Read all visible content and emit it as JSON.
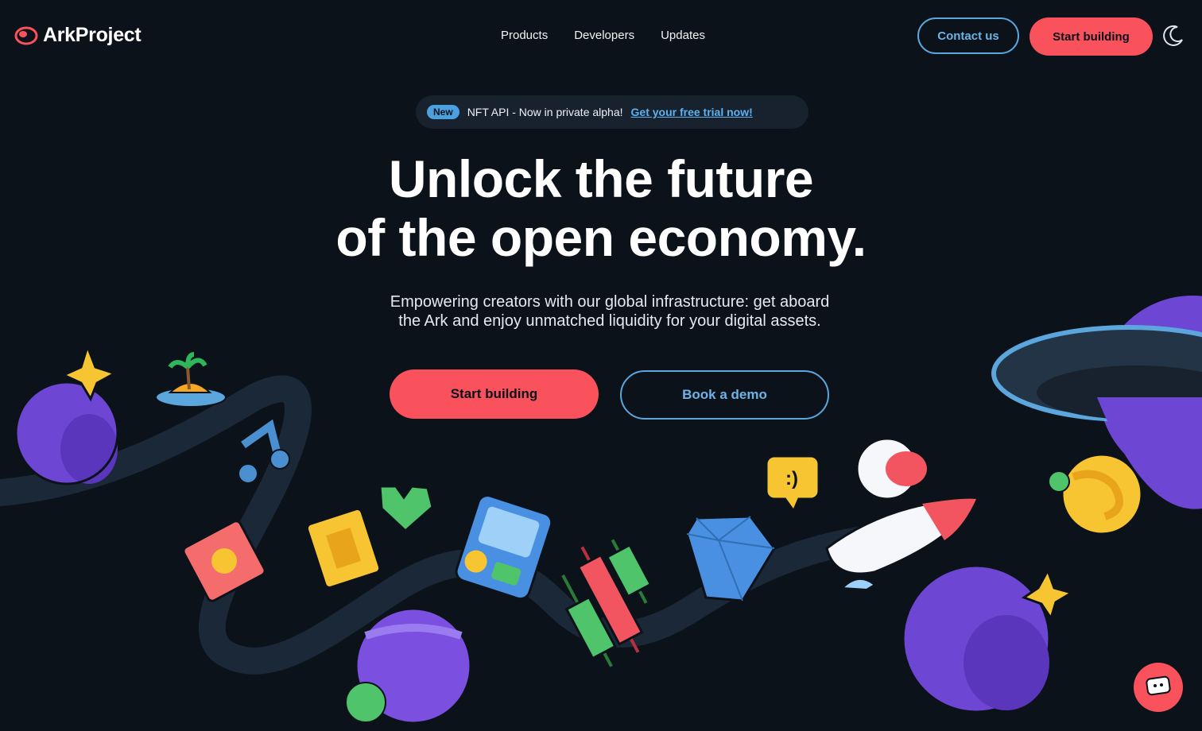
{
  "header": {
    "brand": "ArkProject",
    "nav": [
      "Products",
      "Developers",
      "Updates"
    ],
    "contact_label": "Contact us",
    "start_label": "Start building",
    "theme_icon": "moon-icon"
  },
  "announcement": {
    "badge": "New",
    "text": "NFT API - Now in private alpha!",
    "link": "Get your free trial now!"
  },
  "hero": {
    "title_line1": "Unlock the future",
    "title_line2": "of the open economy.",
    "subtitle_line1": "Empowering creators with our global infrastructure: get aboard",
    "subtitle_line2": "the Ark and enjoy unmatched liquidity for your digital assets.",
    "primary_cta": "Start building",
    "secondary_cta": "Book a demo"
  },
  "colors": {
    "background": "#0b121a",
    "accent_red": "#f9525c",
    "accent_blue": "#5ba7dd",
    "pill_bg": "#17222e"
  },
  "illustration": {
    "icons": [
      "planet-icon",
      "star-icon",
      "island-icon",
      "music-note-icon",
      "ticket-icon",
      "pixel-badge-icon",
      "pixel-heart-icon",
      "game-device-icon",
      "candlestick-icon",
      "gem-icon",
      "chat-bubble-icon",
      "astronaut-rocket-icon",
      "ufo-icon",
      "planet-icon",
      "star-icon"
    ],
    "bubble_text": ":)"
  },
  "chat_widget_icon": "chat-icon"
}
